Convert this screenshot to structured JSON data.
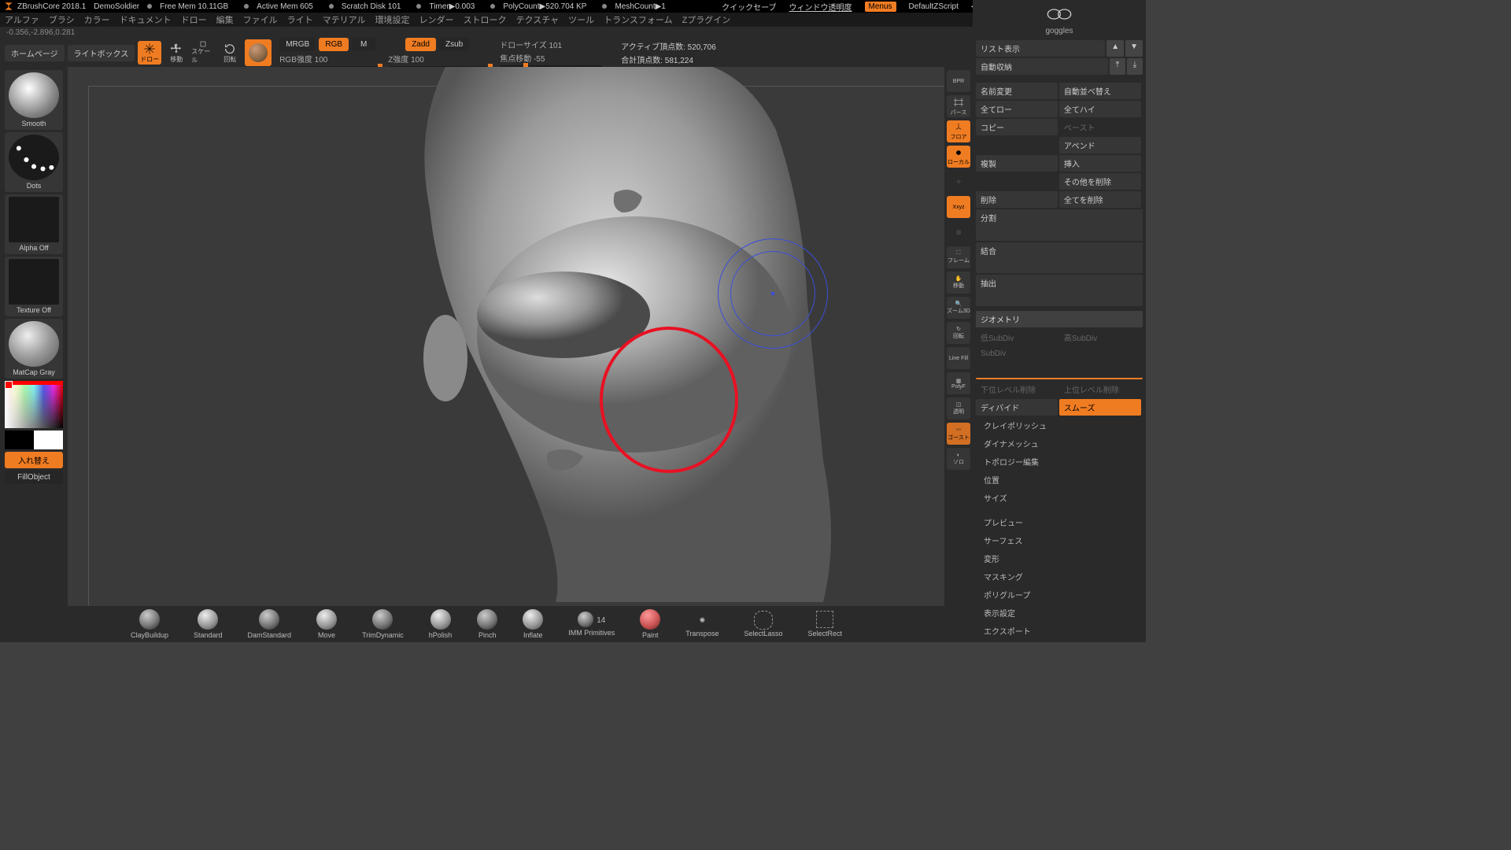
{
  "title": {
    "app": "ZBrushCore 2018.1",
    "project": "DemoSoldier",
    "freemem": "Free Mem 10.11GB",
    "activemem": "Active Mem 605",
    "scratch": "Scratch Disk 101",
    "timer": "Timer▶0.003",
    "polycount": "PolyCount▶520.704 KP",
    "meshcount": "MeshCount▶1",
    "quicksave": "クイックセーブ",
    "transparency": "ウィンドウ透明度",
    "menus": "Menus",
    "zscript": "DefaultZScript"
  },
  "menu": {
    "items": [
      "アルファ",
      "ブラシ",
      "カラー",
      "ドキュメント",
      "ドロー",
      "編集",
      "ファイル",
      "ライト",
      "マテリアル",
      "環境設定",
      "レンダー",
      "ストローク",
      "テクスチャ",
      "ツール",
      "トランスフォーム",
      "Zプラグイン"
    ]
  },
  "coords": "-0.356,-2.896,0.281",
  "topbar": {
    "homepage": "ホームページ",
    "lightbox": "ライトボックス",
    "modes": {
      "draw": "ドロー",
      "move": "移動",
      "scale": "スケール",
      "rotate": "回転"
    },
    "mrgb": "MRGB",
    "rgb": "RGB",
    "m": "M",
    "zadd": "Zadd",
    "zsub": "Zsub",
    "rgbint": "RGB強度 100",
    "zint": "Z強度 100",
    "drawsize": "ドローサイズ 101",
    "focal": "焦点移動 -55",
    "active_pts": "アクティブ頂点数: 520,706",
    "total_pts": "合計頂点数: 581,224"
  },
  "left": {
    "smooth": "Smooth",
    "dots": "Dots",
    "alphaoff": "Alpha Off",
    "texoff": "Texture Off",
    "matcap": "MatCap Gray",
    "swap": "入れ替え",
    "fill": "FillObject"
  },
  "rshelf": {
    "bpr": "BPR",
    "pers": "パース",
    "floor": "フロア",
    "local": "ローカル",
    "xyz": "Xxyz",
    "frame": "フレーム",
    "move": "移動",
    "zoom": "ズーム3D",
    "rotate": "回転",
    "linefill": "Line Fill",
    "polyf": "PolyF",
    "transp": "透明",
    "ghost": "ゴースト",
    "solo": "ソロ"
  },
  "right": {
    "goggles": "goggles",
    "listview": "リスト表示",
    "autostow": "自動収納",
    "rename": "名前変更",
    "autosort": "自動並べ替え",
    "alllow": "全てロー",
    "allhigh": "全てハイ",
    "copy": "コピー",
    "paste": "ペースト",
    "append": "アペンド",
    "dup": "複製",
    "insert": "挿入",
    "delother": "その他を削除",
    "delete": "削除",
    "delall": "全てを削除",
    "split": "分割",
    "merge": "結合",
    "extract": "抽出",
    "geometry": "ジオメトリ",
    "lowsubdiv": "低SubDiv",
    "hisubdiv": "高SubDiv",
    "subdiv": "SubDiv",
    "dellow": "下位レベル削除",
    "delhigh": "上位レベル削除",
    "smooth": "スムーズ",
    "divide": "ディバイド",
    "claypolish": "クレイポリッシュ",
    "dynamesh": "ダイナメッシュ",
    "topoedit": "トポロジー編集",
    "position": "位置",
    "size": "サイズ",
    "preview": "プレビュー",
    "surface": "サーフェス",
    "deform": "変形",
    "masking": "マスキング",
    "polygroup": "ポリグループ",
    "display": "表示設定",
    "export": "エクスポート"
  },
  "brushes": {
    "items": [
      "ClayBuildup",
      "Standard",
      "DamStandard",
      "Move",
      "TrimDynamic",
      "hPolish",
      "Pinch",
      "Inflate",
      "IMM Primitives",
      "Paint",
      "Transpose",
      "SelectLasso",
      "SelectRect"
    ],
    "imm_badge": "14"
  }
}
